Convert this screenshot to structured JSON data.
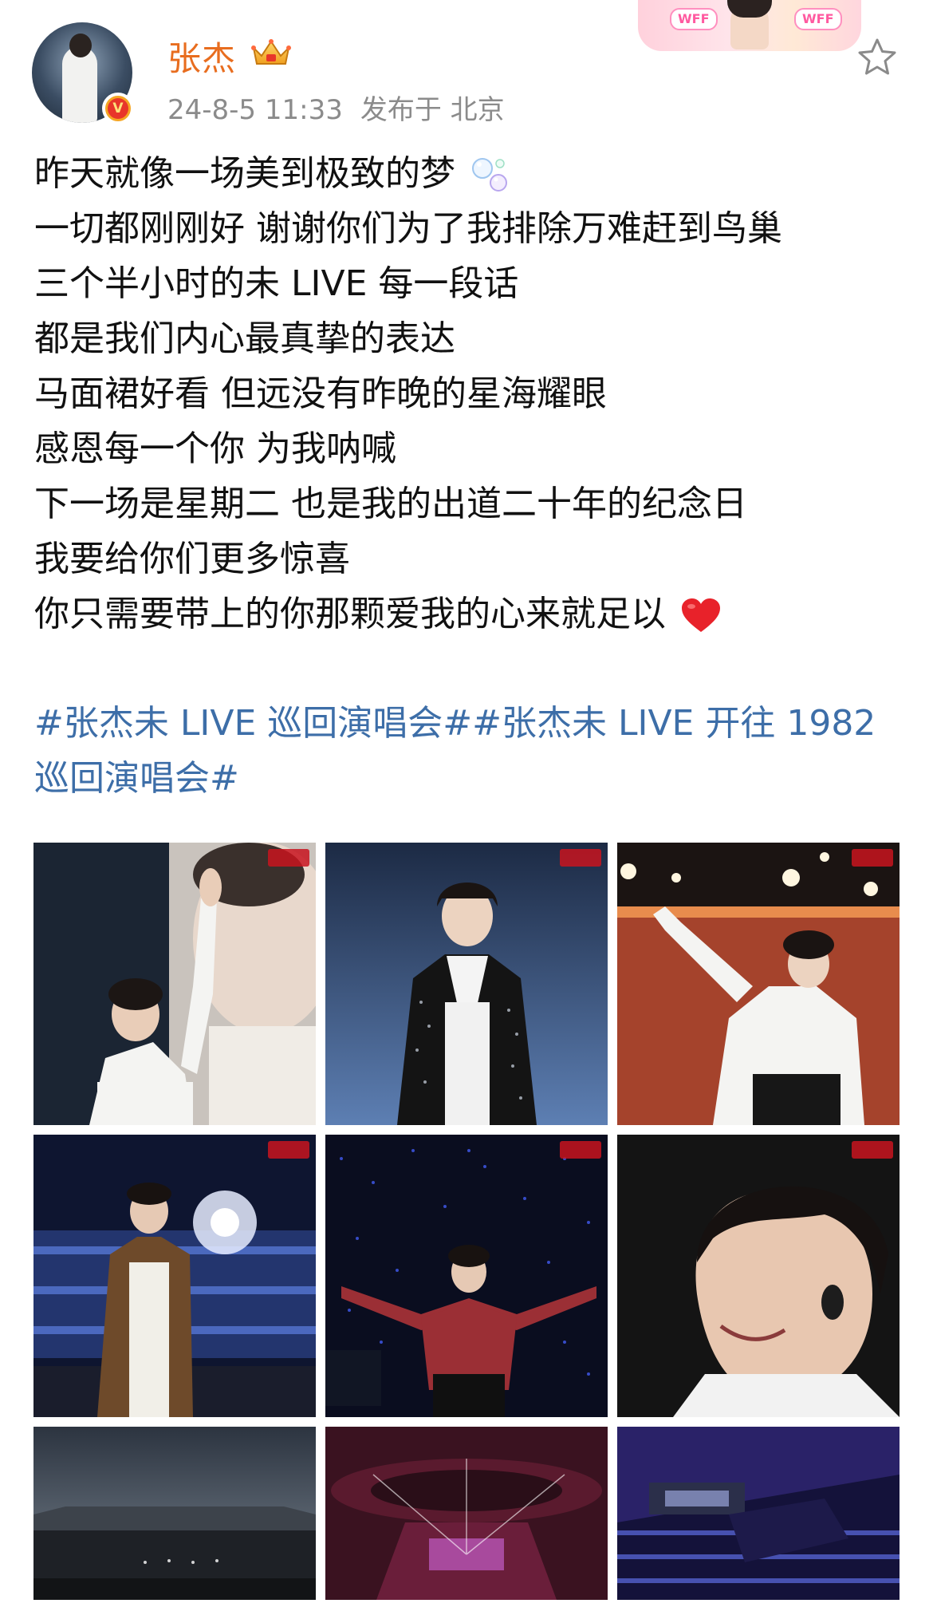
{
  "post": {
    "author": {
      "name": "张杰",
      "verified": true,
      "verified_badge_text": "V",
      "vip": true
    },
    "time": "24-8-5 11:33",
    "location_label": "发布于 北京",
    "fan_decoration": {
      "tag_left": "WFF",
      "tag_right": "WFF"
    },
    "lines": [
      "昨天就像一场美到极致的梦",
      "一切都刚刚好 谢谢你们为了我排除万难赶到鸟巢",
      "三个半小时的未 LIVE 每一段话",
      "都是我们内心最真挚的表达",
      "马面裙好看 但远没有昨晚的星海耀眼",
      "感恩每一个你 为我呐喊",
      "下一场是星期二 也是我的出道二十年的纪念日",
      "我要给你们更多惊喜",
      "你只需要带上的你那颗爱我的心来就足以"
    ],
    "hashtags": {
      "line1_tag1": "#张杰未 LIVE 巡回演唱会#",
      "line1_tag2": "#张杰未 LIVE 开往 1982",
      "line2": "巡回演唱会#"
    },
    "icons": {
      "bubbles": "bubble-emoji",
      "heart": "red-heart-emoji",
      "star": "favorite-star-icon",
      "crown": "vip-crown-icon"
    },
    "colors": {
      "username": "#e86d1f",
      "hashtag": "#3d6ea8",
      "meta": "#8b8b8b",
      "heart": "#e8222a"
    }
  }
}
